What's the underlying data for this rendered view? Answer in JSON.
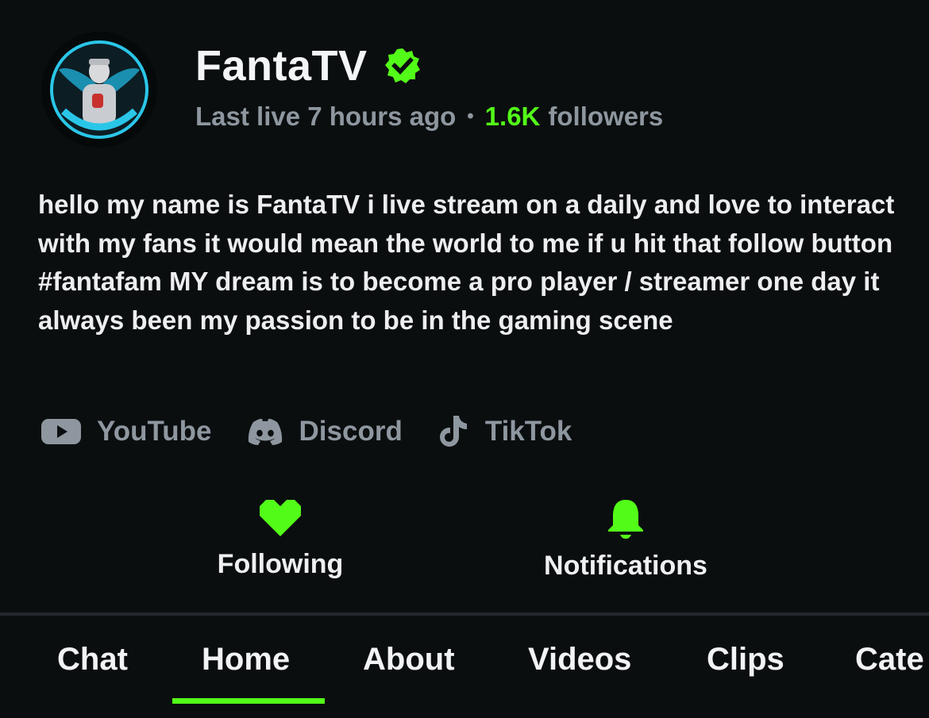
{
  "channel": {
    "name": "FantaTV",
    "last_live": "Last live 7 hours ago",
    "separator": "•",
    "followers_count": "1.6K",
    "followers_label": "followers",
    "verified_icon": "verified-badge-icon",
    "accent_color": "#53fc18"
  },
  "bio": "hello my name is FantaTV i live stream on a daily and love to interact with my fans it would mean the world to me if u hit that follow button #fantafam MY dream is to become a pro player / streamer one day it always been my passion to be in the gaming scene",
  "socials": [
    {
      "label": "YouTube",
      "icon": "youtube-icon"
    },
    {
      "label": "Discord",
      "icon": "discord-icon"
    },
    {
      "label": "TikTok",
      "icon": "tiktok-icon"
    }
  ],
  "actions": {
    "following": {
      "label": "Following",
      "icon": "heart-icon"
    },
    "notifications": {
      "label": "Notifications",
      "icon": "bell-icon"
    }
  },
  "tabs": [
    {
      "label": "Chat"
    },
    {
      "label": "Home",
      "active": true
    },
    {
      "label": "About"
    },
    {
      "label": "Videos"
    },
    {
      "label": "Clips"
    },
    {
      "label": "Cate"
    }
  ]
}
